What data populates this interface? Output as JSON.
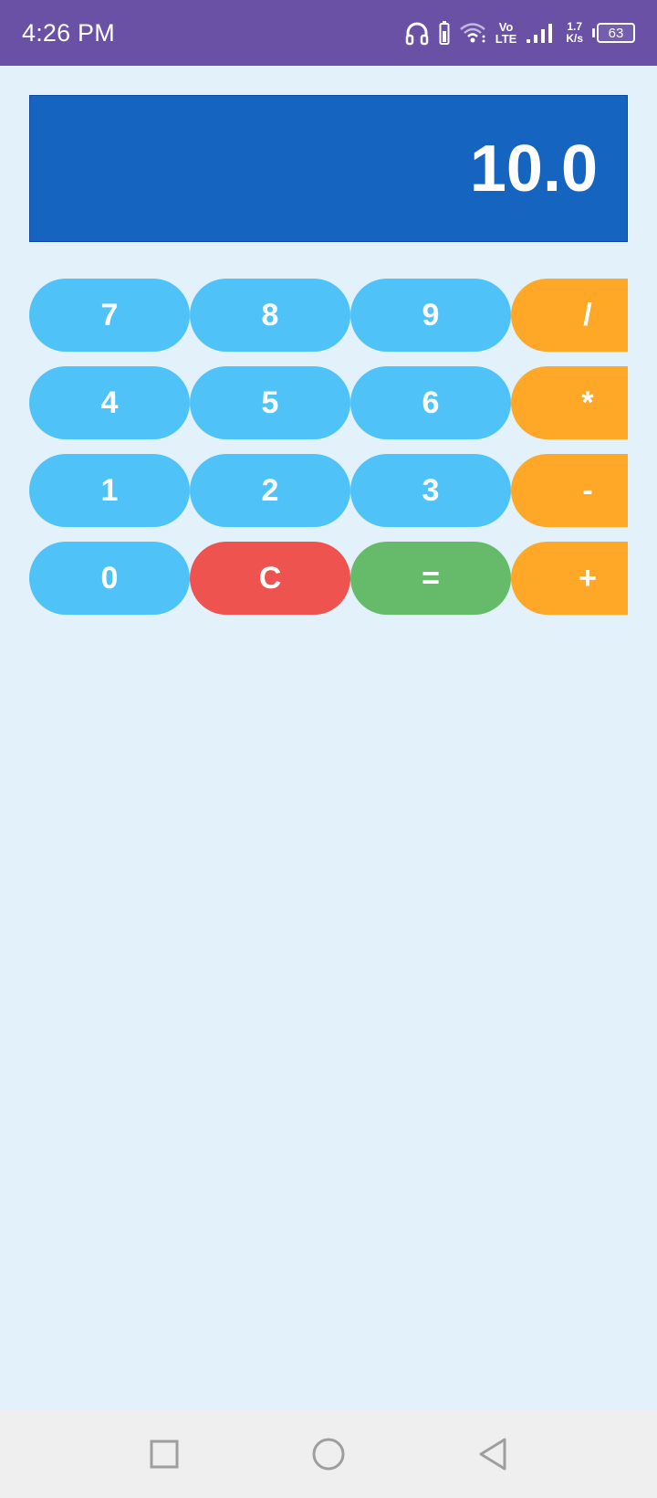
{
  "status_bar": {
    "time": "4:26 PM",
    "network_top": "Vo",
    "network_bottom": "LTE",
    "speed_value": "1.7",
    "speed_unit": "K/s",
    "battery_level": "63",
    "icons": [
      "headphones-icon",
      "battery-saver-icon",
      "wifi-icon",
      "volte-icon",
      "signal-icon",
      "battery-icon"
    ]
  },
  "display": {
    "value": "10.0"
  },
  "keypad": {
    "rows": [
      [
        "7",
        "8",
        "9",
        "/"
      ],
      [
        "4",
        "5",
        "6",
        "*"
      ],
      [
        "1",
        "2",
        "3",
        "-"
      ],
      [
        "0",
        "C",
        "=",
        "+"
      ]
    ]
  },
  "colors": {
    "status_bar": "#6a51a6",
    "background": "#e3f1fb",
    "display": "#1565c0",
    "number_key": "#4fc3f7",
    "operator_key": "#ffa726",
    "clear_key": "#ef5350",
    "equals_key": "#66bb6a",
    "nav_bar": "#efefef"
  },
  "nav_bar": {
    "icons": [
      "recents-icon",
      "home-icon",
      "back-icon"
    ]
  }
}
